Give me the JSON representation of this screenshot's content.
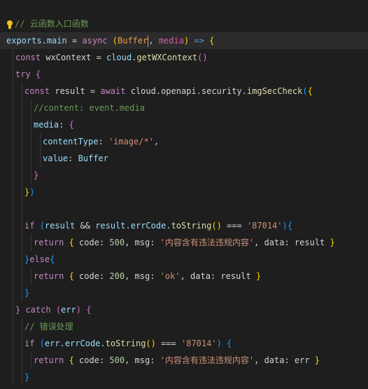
{
  "editor": {
    "lines": [
      {
        "tokens": [
          {
            "t": "// ",
            "c": "tk-comment"
          },
          {
            "t": "云函数入口函数",
            "c": "tk-comment"
          }
        ],
        "indent": 0,
        "icon": "lightbulb-icon"
      },
      {
        "tokens": [
          {
            "t": "exports",
            "c": "tk-var"
          },
          {
            "t": ".",
            "c": "tk-punc"
          },
          {
            "t": "main",
            "c": "tk-var"
          },
          {
            "t": " = ",
            "c": "tk-punc"
          },
          {
            "t": "async",
            "c": "tk-kw"
          },
          {
            "t": " ",
            "c": "tk-punc"
          },
          {
            "t": "(",
            "c": "tk-br1"
          },
          {
            "t": "Buffer",
            "c": "tk-orange"
          },
          {
            "t": ", ",
            "c": "tk-punc"
          },
          {
            "t": "media",
            "c": "tk-pink"
          },
          {
            "t": ")",
            "c": "tk-br1"
          },
          {
            "t": " => ",
            "c": "tk-kw2"
          },
          {
            "t": "{",
            "c": "tk-br1"
          }
        ],
        "indent": 0,
        "highlight": true
      },
      {
        "tokens": [
          {
            "t": "const",
            "c": "tk-kw"
          },
          {
            "t": " wxContext = ",
            "c": "tk-punc"
          },
          {
            "t": "cloud",
            "c": "tk-var"
          },
          {
            "t": ".",
            "c": "tk-punc"
          },
          {
            "t": "getWXContext",
            "c": "tk-fn"
          },
          {
            "t": "()",
            "c": "tk-br2"
          }
        ],
        "indent": 1
      },
      {
        "tokens": [
          {
            "t": "try",
            "c": "tk-kw"
          },
          {
            "t": " ",
            "c": "tk-punc"
          },
          {
            "t": "{",
            "c": "tk-br2"
          }
        ],
        "indent": 1
      },
      {
        "tokens": [
          {
            "t": "const",
            "c": "tk-kw"
          },
          {
            "t": " result = ",
            "c": "tk-punc"
          },
          {
            "t": "await",
            "c": "tk-kw"
          },
          {
            "t": " cloud.openapi.security.",
            "c": "tk-punc"
          },
          {
            "t": "imgSecCheck",
            "c": "tk-fn"
          },
          {
            "t": "(",
            "c": "tk-br3"
          },
          {
            "t": "{",
            "c": "tk-br1"
          }
        ],
        "indent": 2
      },
      {
        "tokens": [
          {
            "t": "//content: event.media",
            "c": "tk-comment"
          }
        ],
        "indent": 3
      },
      {
        "tokens": [
          {
            "t": "media",
            "c": "tk-var"
          },
          {
            "t": ": ",
            "c": "tk-punc"
          },
          {
            "t": "{",
            "c": "tk-br2"
          }
        ],
        "indent": 3
      },
      {
        "tokens": [
          {
            "t": "contentType",
            "c": "tk-var"
          },
          {
            "t": ": ",
            "c": "tk-punc"
          },
          {
            "t": "'image/*'",
            "c": "tk-str"
          },
          {
            "t": ",",
            "c": "tk-punc"
          }
        ],
        "indent": 4
      },
      {
        "tokens": [
          {
            "t": "value",
            "c": "tk-var"
          },
          {
            "t": ": ",
            "c": "tk-punc"
          },
          {
            "t": "Buffer",
            "c": "tk-var"
          }
        ],
        "indent": 4
      },
      {
        "tokens": [
          {
            "t": "}",
            "c": "tk-br2"
          }
        ],
        "indent": 3
      },
      {
        "tokens": [
          {
            "t": "}",
            "c": "tk-br1"
          },
          {
            "t": ")",
            "c": "tk-br3"
          }
        ],
        "indent": 2
      },
      {
        "tokens": [],
        "indent": 2
      },
      {
        "tokens": [
          {
            "t": "if",
            "c": "tk-kw"
          },
          {
            "t": " ",
            "c": "tk-punc"
          },
          {
            "t": "(",
            "c": "tk-br3"
          },
          {
            "t": "result",
            "c": "tk-var"
          },
          {
            "t": " && ",
            "c": "tk-punc"
          },
          {
            "t": "result.errCode.",
            "c": "tk-var"
          },
          {
            "t": "toString",
            "c": "tk-fn"
          },
          {
            "t": "()",
            "c": "tk-br1"
          },
          {
            "t": " === ",
            "c": "tk-punc"
          },
          {
            "t": "'87014'",
            "c": "tk-str"
          },
          {
            "t": ")",
            "c": "tk-br3"
          },
          {
            "t": "{",
            "c": "tk-br3"
          }
        ],
        "indent": 2
      },
      {
        "tokens": [
          {
            "t": "return",
            "c": "tk-kw"
          },
          {
            "t": " ",
            "c": "tk-punc"
          },
          {
            "t": "{",
            "c": "tk-br1"
          },
          {
            "t": " code: ",
            "c": "tk-punc"
          },
          {
            "t": "500",
            "c": "tk-num"
          },
          {
            "t": ", msg: ",
            "c": "tk-punc"
          },
          {
            "t": "'内容含有违法违规内容'",
            "c": "tk-str"
          },
          {
            "t": ", data: result ",
            "c": "tk-punc"
          },
          {
            "t": "}",
            "c": "tk-br1"
          }
        ],
        "indent": 3
      },
      {
        "tokens": [
          {
            "t": "}",
            "c": "tk-br3"
          },
          {
            "t": "else",
            "c": "tk-kw"
          },
          {
            "t": "{",
            "c": "tk-br3"
          }
        ],
        "indent": 2
      },
      {
        "tokens": [
          {
            "t": "return",
            "c": "tk-kw"
          },
          {
            "t": " ",
            "c": "tk-punc"
          },
          {
            "t": "{",
            "c": "tk-br1"
          },
          {
            "t": " code: ",
            "c": "tk-punc"
          },
          {
            "t": "200",
            "c": "tk-num"
          },
          {
            "t": ", msg: ",
            "c": "tk-punc"
          },
          {
            "t": "'ok'",
            "c": "tk-str"
          },
          {
            "t": ", data: result ",
            "c": "tk-punc"
          },
          {
            "t": "}",
            "c": "tk-br1"
          }
        ],
        "indent": 3
      },
      {
        "tokens": [
          {
            "t": "}",
            "c": "tk-br3"
          }
        ],
        "indent": 2
      },
      {
        "tokens": [
          {
            "t": "}",
            "c": "tk-br2"
          },
          {
            "t": " catch ",
            "c": "tk-kw"
          },
          {
            "t": "(",
            "c": "tk-br2"
          },
          {
            "t": "err",
            "c": "tk-var"
          },
          {
            "t": ")",
            "c": "tk-br2"
          },
          {
            "t": " ",
            "c": "tk-punc"
          },
          {
            "t": "{",
            "c": "tk-br2"
          }
        ],
        "indent": 1
      },
      {
        "tokens": [
          {
            "t": "// 错误处理",
            "c": "tk-comment"
          }
        ],
        "indent": 2
      },
      {
        "tokens": [
          {
            "t": "if",
            "c": "tk-kw"
          },
          {
            "t": " ",
            "c": "tk-punc"
          },
          {
            "t": "(",
            "c": "tk-br3"
          },
          {
            "t": "err.errCode.",
            "c": "tk-var"
          },
          {
            "t": "toString",
            "c": "tk-fn"
          },
          {
            "t": "()",
            "c": "tk-br1"
          },
          {
            "t": " === ",
            "c": "tk-punc"
          },
          {
            "t": "'87014'",
            "c": "tk-str"
          },
          {
            "t": ")",
            "c": "tk-br3"
          },
          {
            "t": " ",
            "c": "tk-punc"
          },
          {
            "t": "{",
            "c": "tk-br3"
          }
        ],
        "indent": 2
      },
      {
        "tokens": [
          {
            "t": "return",
            "c": "tk-kw"
          },
          {
            "t": " ",
            "c": "tk-punc"
          },
          {
            "t": "{",
            "c": "tk-br1"
          },
          {
            "t": " code: ",
            "c": "tk-punc"
          },
          {
            "t": "500",
            "c": "tk-num"
          },
          {
            "t": ", msg: ",
            "c": "tk-punc"
          },
          {
            "t": "'内容含有违法违规内容'",
            "c": "tk-str"
          },
          {
            "t": ", data: err ",
            "c": "tk-punc"
          },
          {
            "t": "}",
            "c": "tk-br1"
          }
        ],
        "indent": 3
      },
      {
        "tokens": [
          {
            "t": "}",
            "c": "tk-br3"
          }
        ],
        "indent": 2
      }
    ]
  },
  "colors": {
    "background": "#1e1e1e",
    "highlight_line": "#2b2b2b",
    "bulb": "#f0c419"
  }
}
